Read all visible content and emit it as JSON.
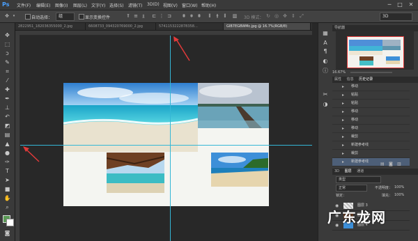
{
  "app": {
    "logo": "Ps"
  },
  "menu": [
    "文件(F)",
    "编辑(E)",
    "图像(I)",
    "图层(L)",
    "文字(Y)",
    "选择(S)",
    "滤镜(T)",
    "3D(D)",
    "视图(V)",
    "窗口(W)",
    "帮助(H)"
  ],
  "window_controls": [
    "─",
    "□",
    "✕"
  ],
  "options": {
    "auto_select_label": "自动选择：",
    "auto_select_value": "组",
    "transform_label": "显示变换控件",
    "mode_label": "3D 模式：",
    "workspace_value": "3D"
  },
  "tabs": [
    "2822951_182036355000_2.jpg",
    "6608733_094320769000_2.jpg",
    "5741153222878358…",
    "GIB7EGBWMc.jpg @ 16.7%(RGB/8)"
  ],
  "navigator": {
    "tab": "导航器",
    "zoom": "16.67%"
  },
  "history": {
    "tabs": [
      "属性",
      "信息",
      "历史记录"
    ],
    "items": [
      {
        "label": "移动",
        "icon": "▸"
      },
      {
        "label": "粘贴",
        "icon": "▸"
      },
      {
        "label": "粘贴",
        "icon": "▸"
      },
      {
        "label": "移动",
        "icon": "▸"
      },
      {
        "label": "移动",
        "icon": "▸"
      },
      {
        "label": "移动",
        "icon": "▸"
      },
      {
        "label": "裁剪",
        "icon": "▸"
      },
      {
        "label": "新建参考线",
        "icon": "▸"
      },
      {
        "label": "裁剪",
        "icon": "▸"
      },
      {
        "label": "新建参考线",
        "icon": "▸",
        "selected": true
      }
    ]
  },
  "layers": {
    "tabs": [
      "3D",
      "图层",
      "通道"
    ],
    "filter_label": "类型",
    "blend_mode": "正常",
    "opacity_label": "不透明度：",
    "opacity_value": "100%",
    "lock_label": "锁定：",
    "fill_label": "填充：",
    "fill_value": "100%",
    "items": [
      {
        "name": "图层 3",
        "selected": false
      },
      {
        "name": "图层 5",
        "selected": false
      },
      {
        "name": "图层 4",
        "selected": false
      }
    ]
  },
  "watermark": "广东龙网"
}
